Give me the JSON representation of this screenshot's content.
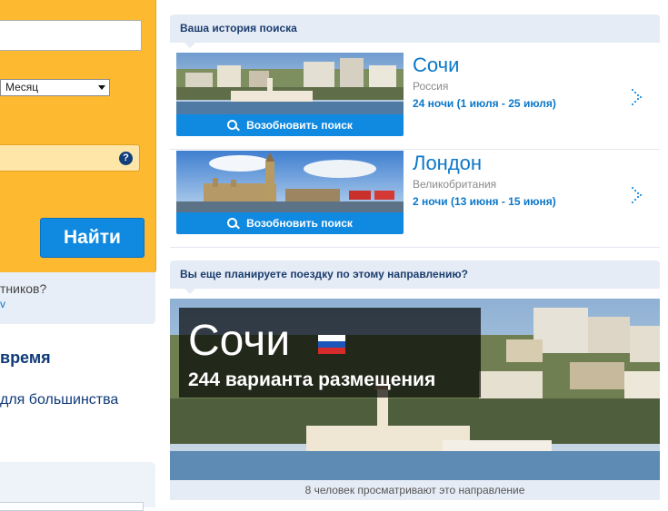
{
  "search_form": {
    "month_select_value": "Месяц",
    "help_icon_glyph": "?",
    "find_button_label": "Найти",
    "info_text": "тников?",
    "info_link": "v"
  },
  "left_promo": {
    "heading": "время",
    "subtext": "для большинства"
  },
  "history": {
    "header": "Ваша история поиска",
    "items": [
      {
        "city": "Сочи",
        "country": "Россия",
        "dates": "24 ночи (1 июля - 25 июля)",
        "resume_label": "Возобновить поиск"
      },
      {
        "city": "Лондон",
        "country": "Великобритания",
        "dates": "2 ночи (13 июня - 15 июня)",
        "resume_label": "Возобновить поиск"
      }
    ]
  },
  "planning": {
    "header": "Вы еще планируете поездку по этому направлению?",
    "city": "Сочи",
    "offers": "244 варианта размещения",
    "viewers": "8 человек просматривают это направление"
  },
  "colors": {
    "search_panel": "#fdb930",
    "primary_button": "#1089e0",
    "link": "#0b77c9",
    "header_bg": "#e6ecf6"
  }
}
